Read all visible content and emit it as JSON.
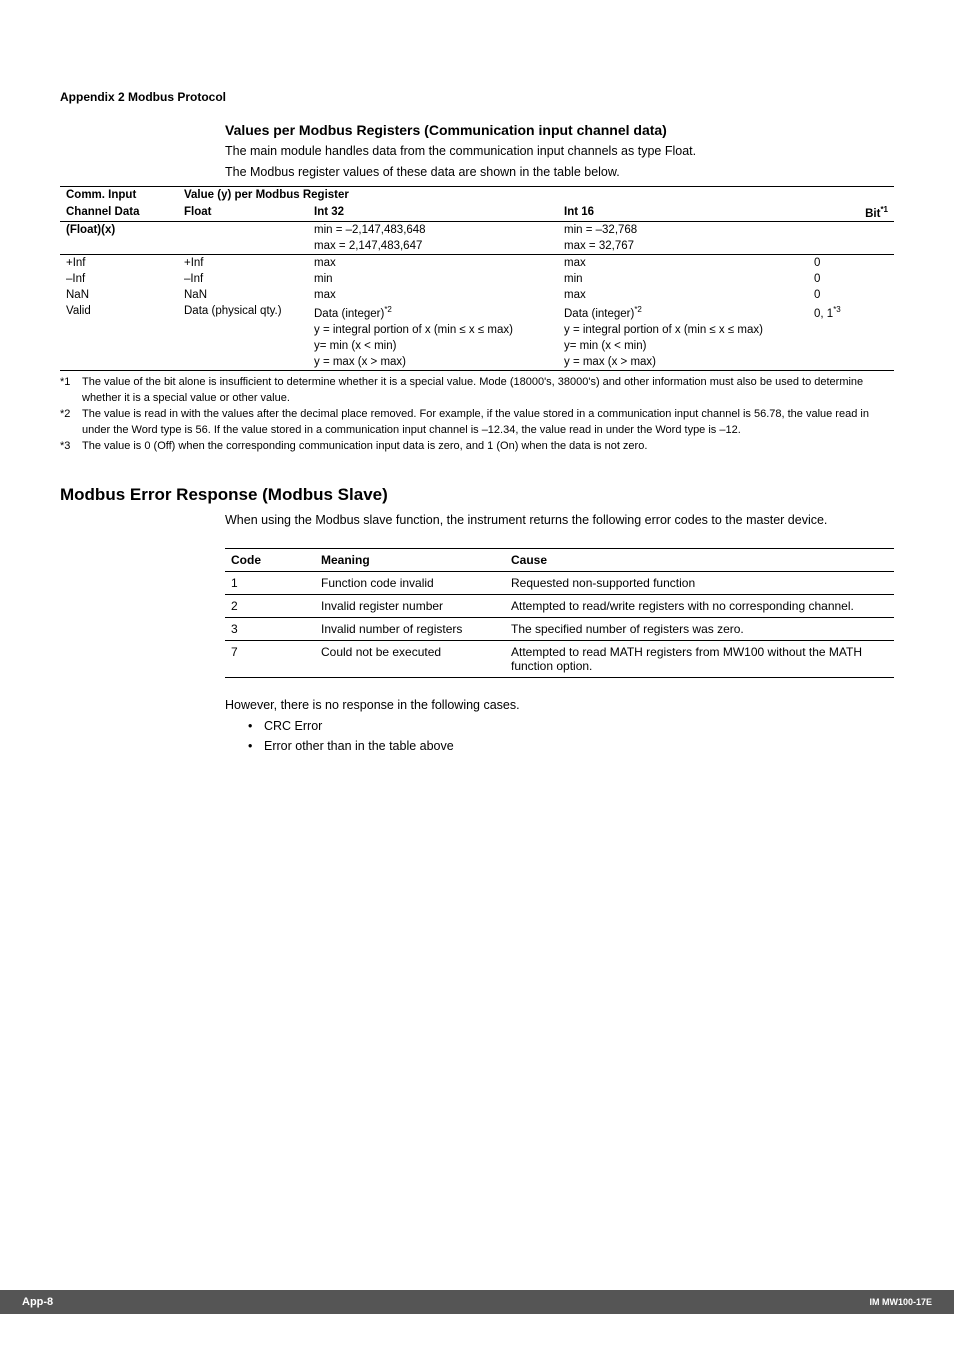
{
  "appendix_header": "Appendix 2  Modbus Protocol",
  "values_section": {
    "title": "Values per Modbus Registers (Communication input channel data)",
    "intro1": "The main module handles data from the communication input channels as type Float.",
    "intro2": "The Modbus register values of these data are shown in the table below.",
    "header": {
      "comm_input_1": "Comm. Input",
      "comm_input_2": "Channel Data",
      "comm_input_3": "(Float)(x)",
      "value_per": "Value (y) per Modbus Register",
      "float": "Float",
      "int32": "Int 32",
      "int16": "Int 16",
      "bit": "Bit",
      "bit_sup": "*1"
    },
    "ranges": {
      "int32_min": "min = –2,147,483,648",
      "int32_max": "max =  2,147,483,647",
      "int16_min": "min = –32,768",
      "int16_max": "max =  32,767"
    },
    "rows": {
      "pinf": {
        "c1": "+Inf",
        "fl": "+Inf",
        "i32": "max",
        "i16": "max",
        "bit": "0"
      },
      "ninf": {
        "c1": "–Inf",
        "fl": "–Inf",
        "i32": "min",
        "i16": "min",
        "bit": "0"
      },
      "nan": {
        "c1": "NaN",
        "fl": "NaN",
        "i32": "max",
        "i16": "max",
        "bit": "0"
      },
      "valid": {
        "c1": "Valid",
        "fl": "Data (physical qty.)",
        "i32_1": "Data (integer)",
        "i32_1_sup": "*2",
        "i32_2": "y = integral portion of x (min ≤ x ≤ max)",
        "i32_3": "y= min (x < min)",
        "i32_4": "y = max (x > max)",
        "i16_1": "Data (integer)",
        "i16_1_sup": "*2",
        "i16_2": "y = integral portion of x (min ≤ x ≤ max)",
        "i16_3": "y= min (x < min)",
        "i16_4": "y = max (x > max)",
        "bit": "0, 1",
        "bit_sup": "*3"
      }
    },
    "footnotes": {
      "f1_m": "*1",
      "f1": "The value of the bit alone is insufficient to determine whether it is a special value. Mode (18000's, 38000's) and other information must also be used to determine whether it is a special value or other value.",
      "f2_m": "*2",
      "f2": "The value is read in with the values after the decimal place removed. For example, if the value stored in a communication input channel is 56.78, the value read in under the Word type is 56. If the value stored in a communication input channel is –12.34, the value read in under the Word type is –12.",
      "f3_m": "*3",
      "f3": "The value is 0 (Off) when the corresponding communication input data is zero, and 1 (On) when the data is not zero."
    }
  },
  "error_section": {
    "title": "Modbus Error Response (Modbus Slave)",
    "intro": "When using the Modbus slave function, the instrument returns the following error codes to the master device.",
    "header": {
      "code": "Code",
      "meaning": "Meaning",
      "cause": "Cause"
    },
    "rows": [
      {
        "code": "1",
        "meaning": "Function code invalid",
        "cause": "Requested non-supported function"
      },
      {
        "code": "2",
        "meaning": "Invalid register number",
        "cause": "Attempted to read/write registers with no corresponding channel."
      },
      {
        "code": "3",
        "meaning": "Invalid number of registers",
        "cause": "The specified number of registers was zero."
      },
      {
        "code": "7",
        "meaning": "Could not be executed",
        "cause": "Attempted to read MATH registers from MW100 without the MATH function option."
      }
    ],
    "outro": "However, there is no response in the following cases.",
    "bullets": [
      "CRC Error",
      "Error other than in the table above"
    ]
  },
  "footer": {
    "left": "App-8",
    "right": "IM MW100-17E"
  },
  "chart_data": {
    "type": "table",
    "tables": [
      {
        "title": "Values per Modbus Registers (Communication input channel data)",
        "columns": [
          "Comm. Input Channel Data (Float)(x)",
          "Float",
          "Int 32",
          "Int 16",
          "Bit"
        ],
        "int32_range": {
          "min": -2147483648,
          "max": 2147483647
        },
        "int16_range": {
          "min": -32768,
          "max": 32767
        },
        "rows": [
          [
            "+Inf",
            "+Inf",
            "max",
            "max",
            "0"
          ],
          [
            "–Inf",
            "–Inf",
            "min",
            "min",
            "0"
          ],
          [
            "NaN",
            "NaN",
            "max",
            "max",
            "0"
          ],
          [
            "Valid",
            "Data (physical qty.)",
            "Data (integer); y = integral portion of x (min ≤ x ≤ max); y = min (x < min); y = max (x > max)",
            "Data (integer); y = integral portion of x (min ≤ x ≤ max); y = min (x < min); y = max (x > max)",
            "0, 1"
          ]
        ]
      },
      {
        "title": "Modbus Error Response (Modbus Slave)",
        "columns": [
          "Code",
          "Meaning",
          "Cause"
        ],
        "rows": [
          [
            "1",
            "Function code invalid",
            "Requested non-supported function"
          ],
          [
            "2",
            "Invalid register number",
            "Attempted to read/write registers with no corresponding channel."
          ],
          [
            "3",
            "Invalid number of registers",
            "The specified number of registers was zero."
          ],
          [
            "7",
            "Could not be executed",
            "Attempted to read MATH registers from MW100 without the MATH function option."
          ]
        ]
      }
    ]
  }
}
